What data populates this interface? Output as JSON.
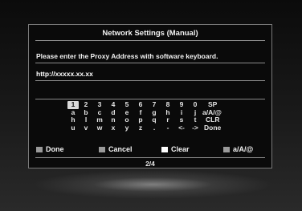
{
  "dialog": {
    "title": "Network Settings (Manual)",
    "prompt": "Please enter the Proxy Address with software keyboard.",
    "input_value": "http://xxxxx.xx.xx",
    "page": "2/4"
  },
  "keyboard": {
    "rows": [
      [
        "1",
        "2",
        "3",
        "4",
        "5",
        "6",
        "7",
        "8",
        "9",
        "0",
        "SP"
      ],
      [
        "a",
        "b",
        "c",
        "d",
        "e",
        "f",
        "g",
        "h",
        "i",
        "j",
        "a/A/@"
      ],
      [
        "h",
        "l",
        "m",
        "n",
        "o",
        "p",
        "q",
        "r",
        "s",
        "t",
        "CLR"
      ],
      [
        "u",
        "v",
        "w",
        "x",
        "y",
        "z",
        ".",
        "-",
        "<-",
        "->",
        "Done"
      ]
    ],
    "selected": "1"
  },
  "actions": {
    "done": "Done",
    "cancel": "Cancel",
    "clear": "Clear",
    "mode": "a/A/@"
  },
  "colors": {
    "panel_border": "#7a7a7a",
    "selected_key_bg": "#d9d9d9",
    "gray_button": "#9a9a9a",
    "white_button": "#ffffff"
  }
}
